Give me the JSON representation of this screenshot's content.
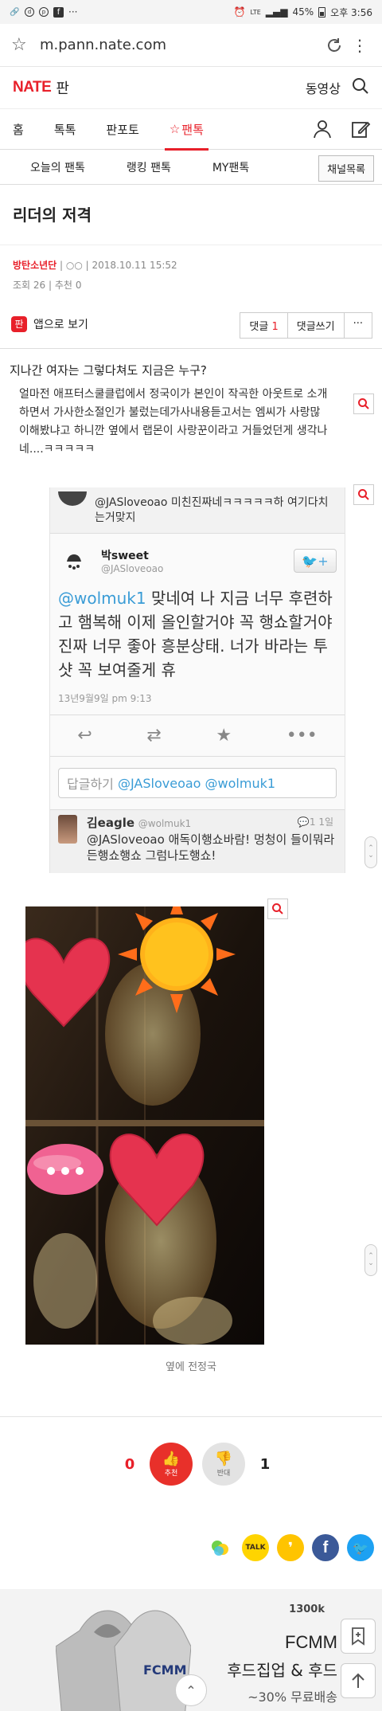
{
  "status_bar": {
    "battery": "45%",
    "time": "오후 3:56",
    "network": "LTE"
  },
  "browser": {
    "url": "m.pann.nate.com"
  },
  "site": {
    "logo": "NATE",
    "section": "판",
    "video_link": "동영상"
  },
  "nav": {
    "items": [
      {
        "label": "홈"
      },
      {
        "label": "톡톡"
      },
      {
        "label": "판포토"
      },
      {
        "label": "팬톡",
        "active": true
      }
    ]
  },
  "subnav": {
    "items": [
      {
        "label": "오늘의 팬톡"
      },
      {
        "label": "랭킹 팬톡"
      },
      {
        "label": "MY팬톡"
      }
    ],
    "channel_button": "채널목록"
  },
  "article": {
    "title": "리더의 저격",
    "author": "방탄소년단",
    "author_suffix": "○○",
    "date": "2018.10.11 15:52",
    "views_label": "조회",
    "views": "26",
    "recommend_label": "추천",
    "recommend": "0",
    "app_view": "앱으로 보기",
    "comment_label": "댓글",
    "comment_count": "1",
    "write_comment": "댓글쓰기",
    "question": "지나간 여자는 그렇다쳐도 지금은 누구?",
    "body_lines": [
      "얼마전 애프터스쿨클럽에서 정국이가 본인이 작곡한 아웃트로 소개",
      "하면서 가사한소절인가 불렀는데가사내용듣고서는 엠씨가 사랑많",
      "이해봤냐고 하니깐 옆에서 랩몬이 사랑꾼이라고 거들었던게 생각나",
      "네....ㅋㅋㅋㅋㅋ"
    ],
    "photo_caption": "옆에 전정국"
  },
  "tweet": {
    "top_reply": "@JASloveoao 미친진짜네ㅋㅋㅋㅋㅋ하 여기다치는거맞지",
    "name": "박sweet",
    "handle": "@JASloveoao",
    "mention": "@wolmuk1",
    "text": " 맞네여 나 지금 너무 후련하고 햄복해 이제 올인할거야 꼭 행쇼할거야 진짜 너무 좋아 흥분상태. 너가 바라는 투샷 꼭 보여줄게 휴",
    "date": "13년9월9일 pm 9:13",
    "reply_placeholder": "답글하기",
    "reply_mentions": "@JASloveoao @wolmuk1",
    "comment_name": "김eagle",
    "comment_handle": "@wolmuk1",
    "comment_text": "@JASloveoao 애독이행쇼바람! 멍청이 들이뭐라든행쇼행쇼 그럼나도행쇼!",
    "comment_time": "1일",
    "comment_count": "1"
  },
  "votes": {
    "up": "0",
    "up_label": "추천",
    "down": "1",
    "down_label": "반대"
  },
  "share": [
    {
      "name": "band",
      "label": ""
    },
    {
      "name": "kakaotalk",
      "label": "TALK"
    },
    {
      "name": "kakaostory",
      "label": ""
    },
    {
      "name": "facebook",
      "label": "f"
    },
    {
      "name": "twitter",
      "label": ""
    }
  ],
  "ad": {
    "brand": "1300k",
    "title": "FCMM",
    "title2": "후드집업 & 후드",
    "sub": "~30% 무료배송",
    "hoodie_text": "FCMM"
  },
  "colors": {
    "accent": "#e8202a",
    "twitter": "#3a9cd6"
  }
}
